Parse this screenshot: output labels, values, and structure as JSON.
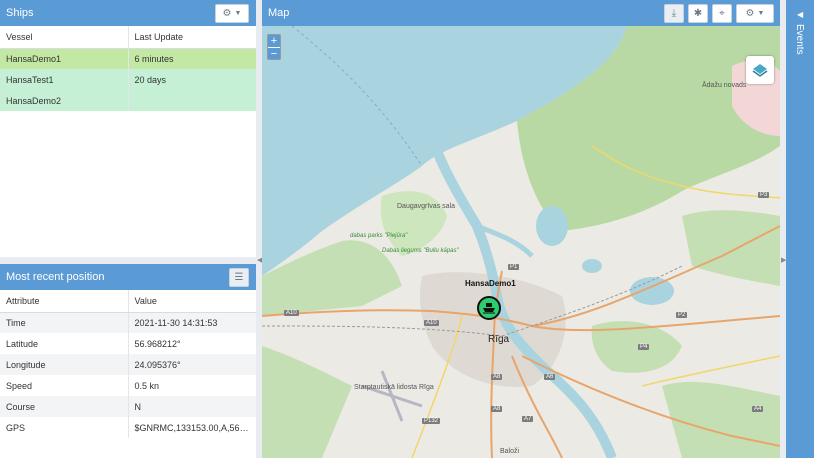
{
  "ships": {
    "title": "Ships",
    "columns": [
      "Vessel",
      "Last Update"
    ],
    "rows": [
      {
        "vessel": "HansaDemo1",
        "last_update": "6 minutes"
      },
      {
        "vessel": "HansaTest1",
        "last_update": "20 days"
      },
      {
        "vessel": "HansaDemo2",
        "last_update": ""
      }
    ],
    "settings_icon": "gear-icon"
  },
  "recent": {
    "title": "Most recent position",
    "columns": [
      "Attribute",
      "Value"
    ],
    "rows": [
      {
        "attr": "Time",
        "value": "2021-11-30 14:31:53"
      },
      {
        "attr": "Latitude",
        "value": "56.968212°"
      },
      {
        "attr": "Longitude",
        "value": "24.095376°"
      },
      {
        "attr": "Speed",
        "value": "0.5 kn"
      },
      {
        "attr": "Course",
        "value": "N"
      },
      {
        "attr": "GPS",
        "value": "$GNRMC,133153.00,A,5658...."
      }
    ]
  },
  "map": {
    "title": "Map",
    "zoom_in": "+",
    "zoom_out": "−",
    "vessel_label": "HansaDemo1",
    "labels": {
      "riga": "Rīga",
      "daugavgrivas": "Daugavgrīvas sala",
      "dabas_parks": "dabas parks \"Piejūra\"",
      "dabas_liegums": "Dabas liegums \"Bullu kāpas\"",
      "starptautiska": "Starptautiskā lidosta Rīga",
      "balozi": "Baloži",
      "adazu": "Ādažu novads"
    },
    "roads": [
      "A10",
      "A10",
      "P1",
      "A8",
      "A8",
      "A7",
      "A6",
      "P4",
      "P2",
      "P3",
      "A4",
      "P132"
    ]
  },
  "events": {
    "title": "Events"
  }
}
